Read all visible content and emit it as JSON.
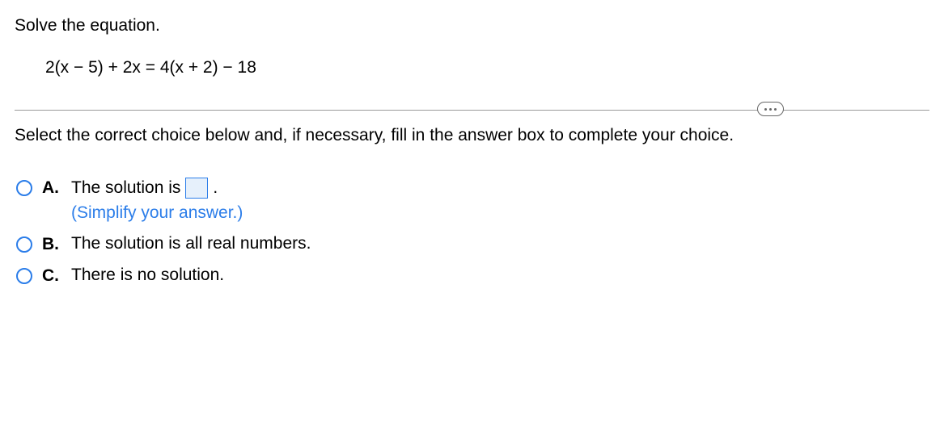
{
  "instruction": "Solve the equation.",
  "equation": "2(x − 5) + 2x = 4(x + 2) − 18",
  "prompt": "Select the correct choice below and, if necessary, fill in the answer box to complete your choice.",
  "choices": {
    "a": {
      "letter": "A.",
      "text_before": "The solution is",
      "text_after": ".",
      "hint": "(Simplify your answer.)"
    },
    "b": {
      "letter": "B.",
      "text": "The solution is all real numbers."
    },
    "c": {
      "letter": "C.",
      "text": "There is no solution."
    }
  }
}
